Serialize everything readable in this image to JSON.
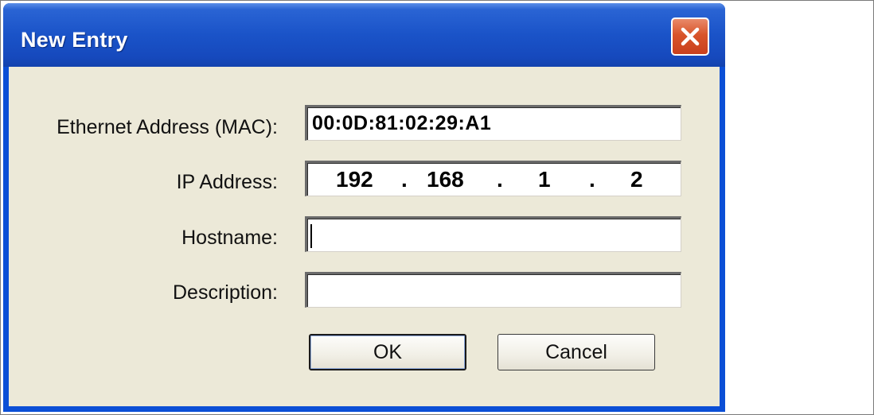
{
  "window": {
    "title": "New Entry",
    "close_icon": "close-icon"
  },
  "form": {
    "mac_label": "Ethernet Address (MAC):",
    "mac_value": "00:0D:81:02:29:A1",
    "ip_label": "IP Address:",
    "ip_octets": [
      "192",
      "168",
      "1",
      "2"
    ],
    "ip_separator": ".",
    "hostname_label": "Hostname:",
    "hostname_value": "",
    "description_label": "Description:",
    "description_value": ""
  },
  "buttons": {
    "ok_label": "OK",
    "cancel_label": "Cancel"
  },
  "colors": {
    "titlebar": "#1a53c8",
    "client_background": "#ece9d8",
    "close_button": "#d8542a"
  }
}
